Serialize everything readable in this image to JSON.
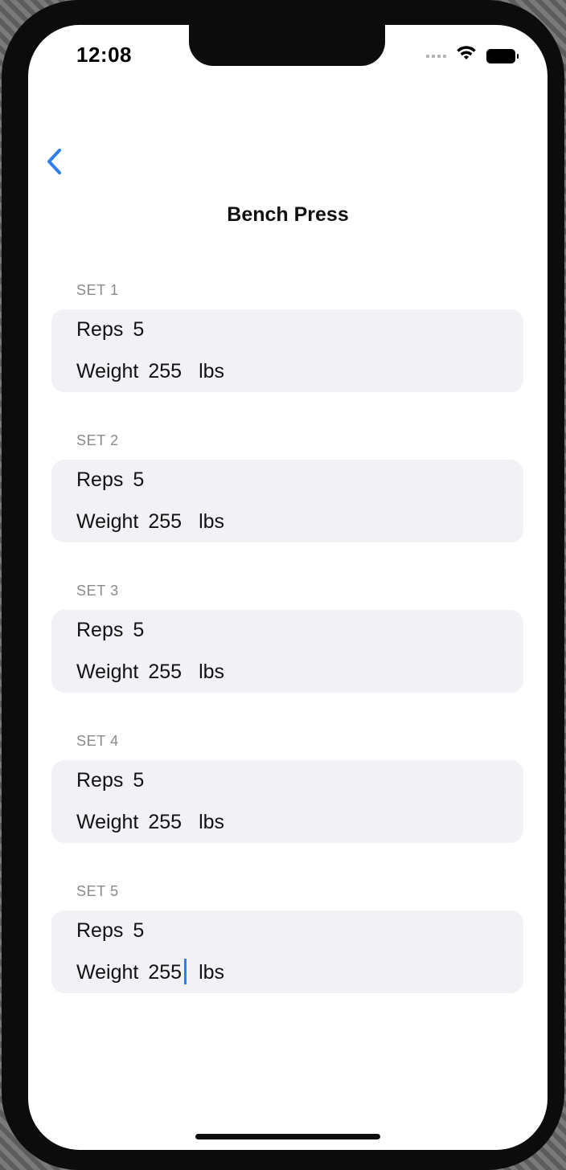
{
  "status_bar": {
    "time": "12:08"
  },
  "nav": {
    "title": "Bench Press",
    "back_icon": "chevron-left-icon"
  },
  "colors": {
    "accent": "#2f7ef0",
    "card_background": "#f2f2f6",
    "section_header": "#8a8a8e"
  },
  "sets": [
    {
      "header": "SET 1",
      "reps_label": "Reps",
      "reps_value": "5",
      "weight_label": "Weight",
      "weight_value": "255",
      "unit": "lbs"
    },
    {
      "header": "SET 2",
      "reps_label": "Reps",
      "reps_value": "5",
      "weight_label": "Weight",
      "weight_value": "255",
      "unit": "lbs"
    },
    {
      "header": "SET 3",
      "reps_label": "Reps",
      "reps_value": "5",
      "weight_label": "Weight",
      "weight_value": "255",
      "unit": "lbs"
    },
    {
      "header": "SET 4",
      "reps_label": "Reps",
      "reps_value": "5",
      "weight_label": "Weight",
      "weight_value": "255",
      "unit": "lbs"
    },
    {
      "header": "SET 5",
      "reps_label": "Reps",
      "reps_value": "5",
      "weight_label": "Weight",
      "weight_value": "255",
      "unit": "lbs"
    }
  ]
}
